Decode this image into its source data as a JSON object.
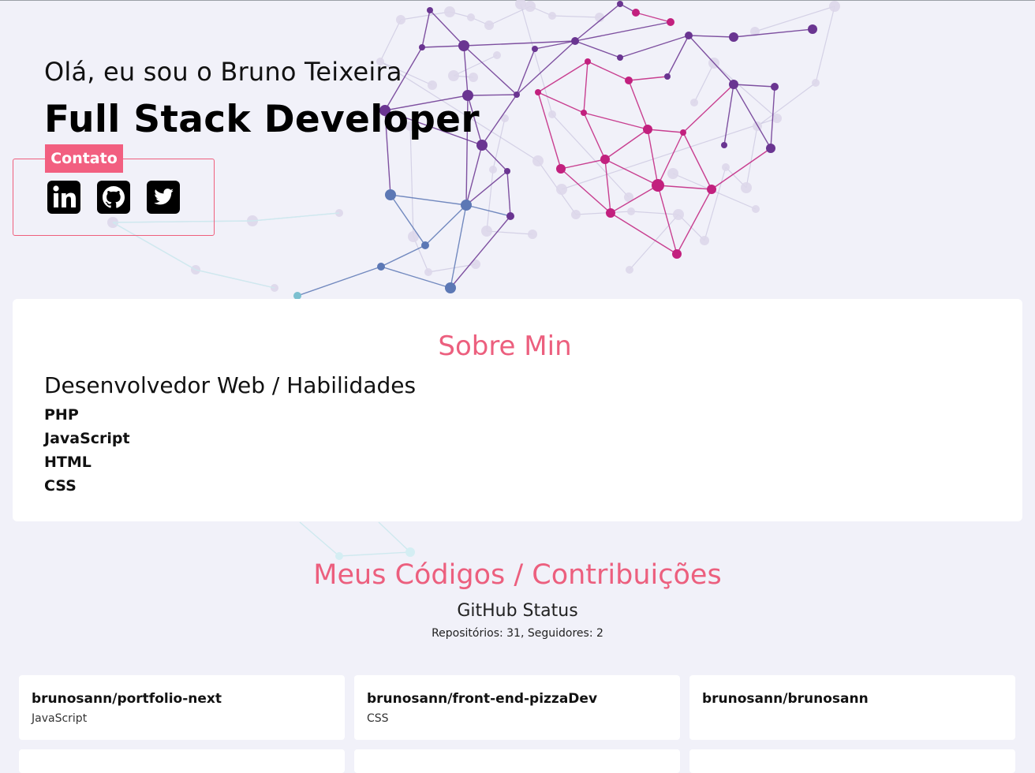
{
  "hero": {
    "greeting": "Olá, eu sou o Bruno Teixeira",
    "role": "Full Stack Developer",
    "contact_label": "Contato",
    "social_icons": [
      "linkedin-icon",
      "github-icon",
      "twitter-icon"
    ]
  },
  "about": {
    "title": "Sobre Min",
    "subtitle": "Desenvolvedor Web / Habilidades",
    "skills": [
      "PHP",
      "JavaScript",
      "HTML",
      "CSS"
    ]
  },
  "codes": {
    "title": "Meus Códigos / Contribuições",
    "status_title": "GitHub Status",
    "stats": "Repositórios: 31, Seguidores: 2"
  },
  "repos": [
    {
      "name": "brunosann/portfolio-next",
      "language": "JavaScript"
    },
    {
      "name": "brunosann/front-end-pizzaDev",
      "language": "CSS"
    },
    {
      "name": "brunosann/brunosann",
      "language": ""
    }
  ],
  "colors": {
    "accent": "#f25f80",
    "background": "#f1f1f9",
    "card": "#ffffff",
    "network_purple": "#6a3591",
    "network_magenta": "#c2207e",
    "network_blue": "#5c78b5",
    "network_cyan": "#7cc0d0"
  }
}
